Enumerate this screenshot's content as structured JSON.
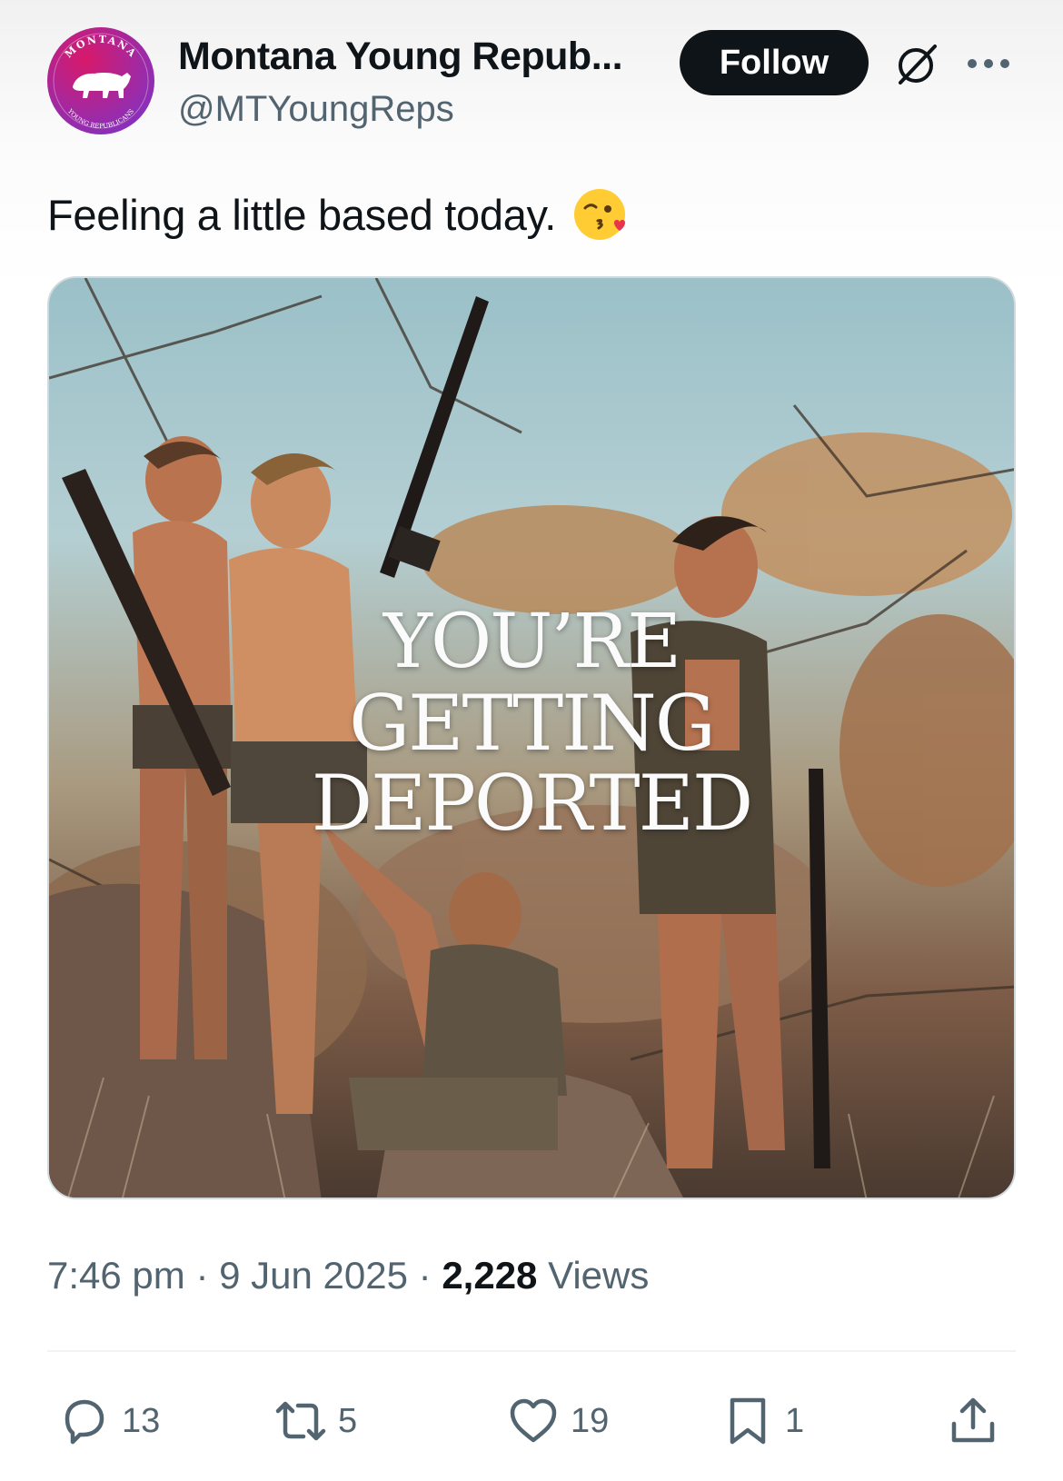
{
  "account": {
    "display_name": "Montana Young Repub...",
    "handle": "@MTYoungReps",
    "avatar_top_text": "MONTANA",
    "avatar_bottom_text": "YOUNG REPUBLICANS"
  },
  "header": {
    "follow_label": "Follow",
    "grok_icon": "grok-icon",
    "more_icon": "more-horizontal-icon"
  },
  "tweet": {
    "text": "Feeling a little based today.",
    "emoji": "face-blowing-a-kiss-emoji",
    "image_overlay_lines": [
      "YOU’RE",
      "GETTING",
      "DEPORTED"
    ]
  },
  "meta": {
    "time": "7:46 pm",
    "separator": "·",
    "date": "9 Jun 2025",
    "views_count": "2,228",
    "views_label": "Views"
  },
  "actions": {
    "replies": "13",
    "reposts": "5",
    "likes": "19",
    "bookmarks": "1"
  },
  "colors": {
    "text_primary": "#0f1419",
    "text_secondary": "#536471",
    "avatar_gradient": [
      "#d8196a",
      "#8b2fb8"
    ]
  }
}
